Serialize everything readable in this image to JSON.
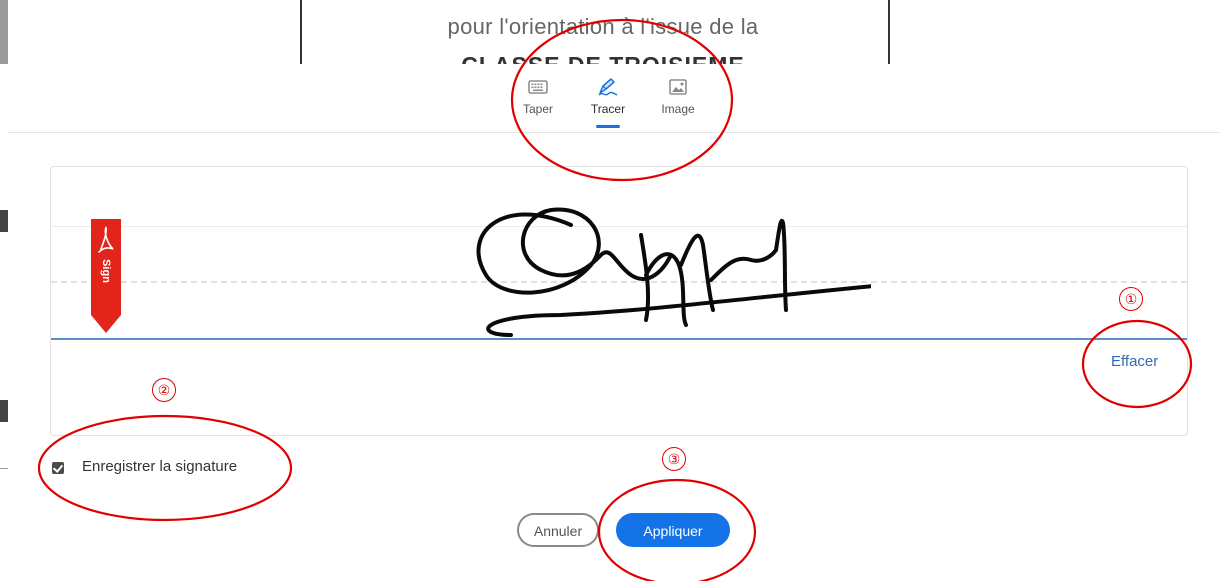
{
  "document": {
    "line1": "pour l'orientation à l'issue de la",
    "line2": "CLASSE DE TROISIEME"
  },
  "tabs": [
    {
      "label": "Taper",
      "icon": "keyboard-icon",
      "active": false
    },
    {
      "label": "Tracer",
      "icon": "pen-draw-icon",
      "active": true
    },
    {
      "label": "Image",
      "icon": "image-icon",
      "active": false
    }
  ],
  "sign_flag": {
    "label": "Sign",
    "icon": "adobe-acrobat-icon",
    "color": "#e1251b"
  },
  "clear_label": "Effacer",
  "save_signature": {
    "label": "Enregistrer la signature",
    "checked": true
  },
  "buttons": {
    "cancel": "Annuler",
    "apply": "Appliquer"
  },
  "annotation_markers": [
    "①",
    "②",
    "③"
  ],
  "colors": {
    "accent": "#1473e6",
    "annotation": "#e00000",
    "baseline": "#5b8ec6"
  }
}
